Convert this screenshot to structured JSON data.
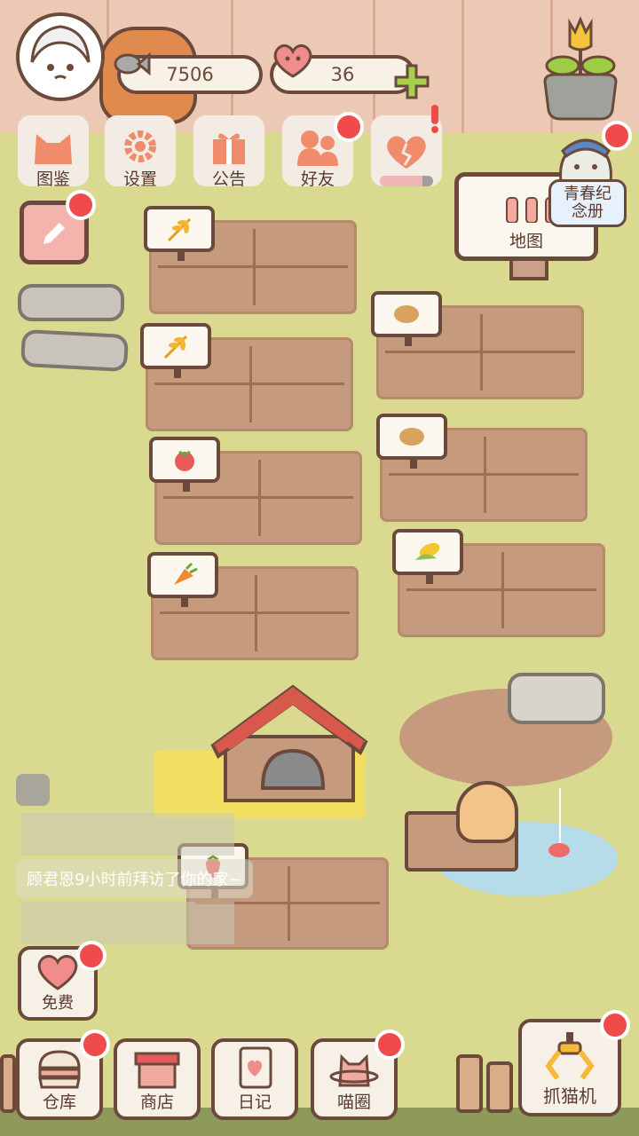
{
  "top_bar": {
    "fish_count": "7506",
    "heart_count": "36"
  },
  "menu": [
    {
      "label": "图鉴"
    },
    {
      "label": "设置"
    },
    {
      "label": "公告"
    },
    {
      "label": "好友"
    },
    {
      "label": ""
    }
  ],
  "yearbook_label": "青春纪念册",
  "map_label": "地图",
  "toast_text": "顾君恩9小时前拜访了你的家~",
  "free_label": "免费",
  "bottom_nav": [
    {
      "label": "仓库"
    },
    {
      "label": "商店"
    },
    {
      "label": "日记"
    },
    {
      "label": "喵圈"
    }
  ],
  "claw_label": "抓猫机",
  "crops": [
    "wheat",
    "wheat",
    "tomato",
    "carrot",
    "potato",
    "potato",
    "corn",
    "strawberry"
  ],
  "colors": {
    "badge": "#ef4b4b",
    "accent_green": "#8bc34a",
    "outline": "#6b4a3b"
  }
}
